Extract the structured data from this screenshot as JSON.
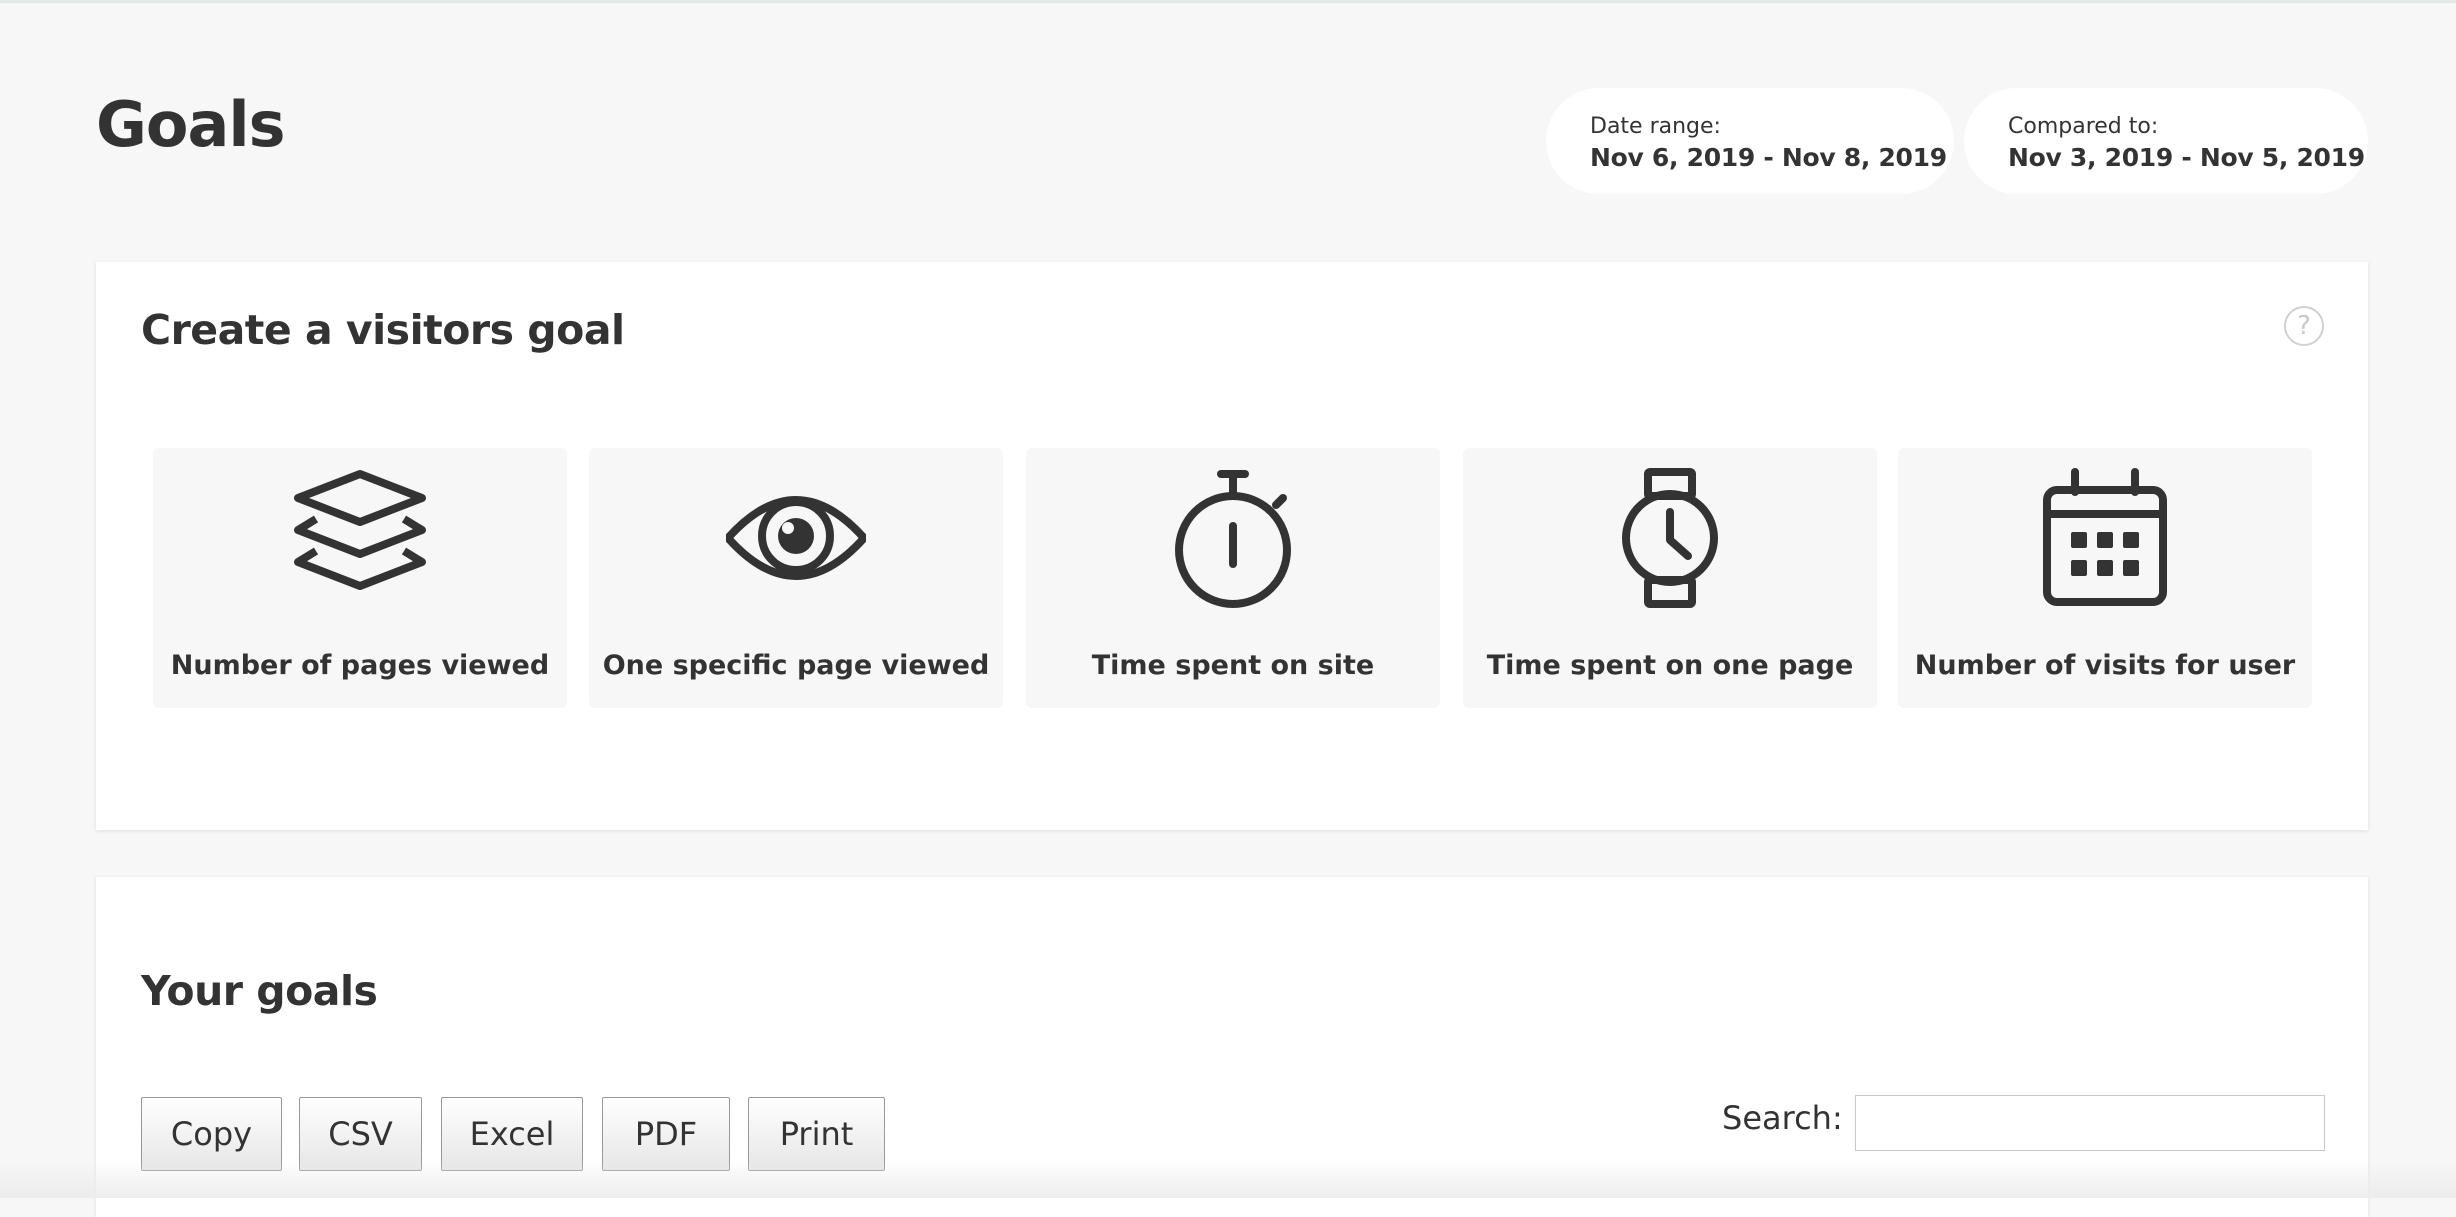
{
  "header": {
    "title": "Goals",
    "date_range": {
      "label": "Date range:",
      "value": "Nov 6, 2019 - Nov 8, 2019"
    },
    "compared_to": {
      "label": "Compared to:",
      "value": "Nov 3, 2019 - Nov 5, 2019"
    }
  },
  "create_goal": {
    "title": "Create a visitors goal",
    "help_icon": "question-circle-icon",
    "help_glyph": "?",
    "cards": [
      {
        "label": "Number of pages viewed",
        "icon": "layers-icon"
      },
      {
        "label": "One specific page viewed",
        "icon": "eye-icon"
      },
      {
        "label": "Time spent on site",
        "icon": "stopwatch-icon"
      },
      {
        "label": "Time spent on one page",
        "icon": "watch-icon"
      },
      {
        "label": "Number of visits for user",
        "icon": "calendar-icon"
      }
    ]
  },
  "your_goals": {
    "title": "Your goals",
    "buttons": [
      "Copy",
      "CSV",
      "Excel",
      "PDF",
      "Print"
    ],
    "search": {
      "label": "Search:",
      "value": "",
      "placeholder": ""
    }
  },
  "colors": {
    "background": "#f7f7f7",
    "panel": "#ffffff",
    "text": "#333333",
    "card": "#f7f7f7"
  }
}
